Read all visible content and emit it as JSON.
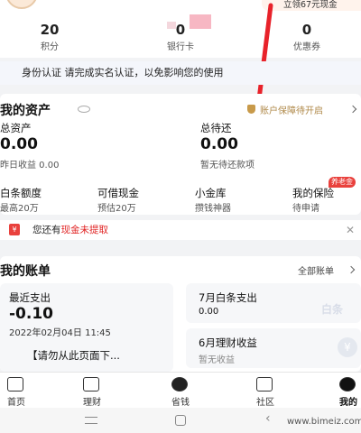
{
  "header": {
    "promo_text": "立领67元现金",
    "stats": [
      {
        "value": "20",
        "label": "积分"
      },
      {
        "value": "0",
        "label": "银行卡"
      },
      {
        "value": "0",
        "label": "优惠券"
      }
    ]
  },
  "banner": {
    "text": "身份认证 请完成实名认证，以免影响您的使用"
  },
  "assets": {
    "title": "我的资产",
    "protection": "账户保障待开启",
    "total_assets_label": "总资产",
    "total_assets_value": "0.00",
    "yesterday_income": "昨日收益 0.00",
    "total_due_label": "总待还",
    "total_due_value": "0.00",
    "no_due": "暂无待还款项",
    "items": [
      {
        "title": "白条额度",
        "sub": "最高20万"
      },
      {
        "title": "可借现金",
        "sub": "预估20万"
      },
      {
        "title": "小金库",
        "sub": "攒钱神器"
      },
      {
        "title": "我的保险",
        "sub": "待申请"
      }
    ],
    "insurance_tag": "养老金"
  },
  "notice": {
    "icon_text": "¥",
    "prefix": "您还有",
    "highlight": "现金未提取"
  },
  "bills": {
    "title": "我的账单",
    "all_label": "全部账单",
    "recent_label": "最近支出",
    "recent_value": "-0.10",
    "recent_time": "2022年02月04日  11:45",
    "recent_desc": "【请勿从此页面下...",
    "baitiao_label": "7月白条支出",
    "baitiao_value": "0.00",
    "finance_label": "6月理财收益",
    "finance_value": "暂无收益",
    "watermark_bt": "白条"
  },
  "tabs": [
    {
      "label": "首页"
    },
    {
      "label": "理财"
    },
    {
      "label": "省钱"
    },
    {
      "label": "社区"
    },
    {
      "label": "我的"
    }
  ],
  "site_watermark": "www.bimeiz.com",
  "colors": {
    "accent": "#e9413d",
    "link": "#e02020",
    "gold": "#c89a4a"
  }
}
